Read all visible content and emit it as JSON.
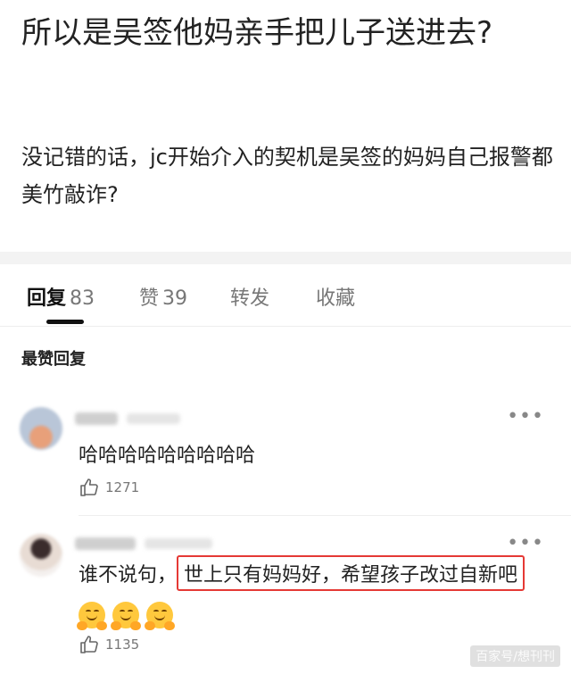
{
  "post": {
    "title": "所以是吴签他妈亲手把儿子送进去?",
    "body": "没记错的话，jc开始介入的契机是吴签的妈妈自己报警都美竹敲诈?"
  },
  "tabs": [
    {
      "label": "回复",
      "count": "83",
      "active": true
    },
    {
      "label": "赞",
      "count": "39",
      "active": false
    },
    {
      "label": "转发",
      "count": "",
      "active": false
    },
    {
      "label": "收藏",
      "count": "",
      "active": false
    }
  ],
  "section_title": "最赞回复",
  "comments": [
    {
      "text": "哈哈哈哈哈哈哈哈哈",
      "likes": "1271",
      "more": "•••"
    },
    {
      "text_prefix": "谁不说句，",
      "text_highlight": "世上只有妈妈好，希望孩子改过自新吧",
      "emojis": [
        "hug-emoji",
        "hug-emoji",
        "hug-emoji"
      ],
      "likes": "1135",
      "more": "•••"
    }
  ],
  "watermark": "百家号/想刊刊",
  "colors": {
    "highlight_border": "#e53935",
    "active_tab": "#111111",
    "inactive_tab": "#777777"
  }
}
